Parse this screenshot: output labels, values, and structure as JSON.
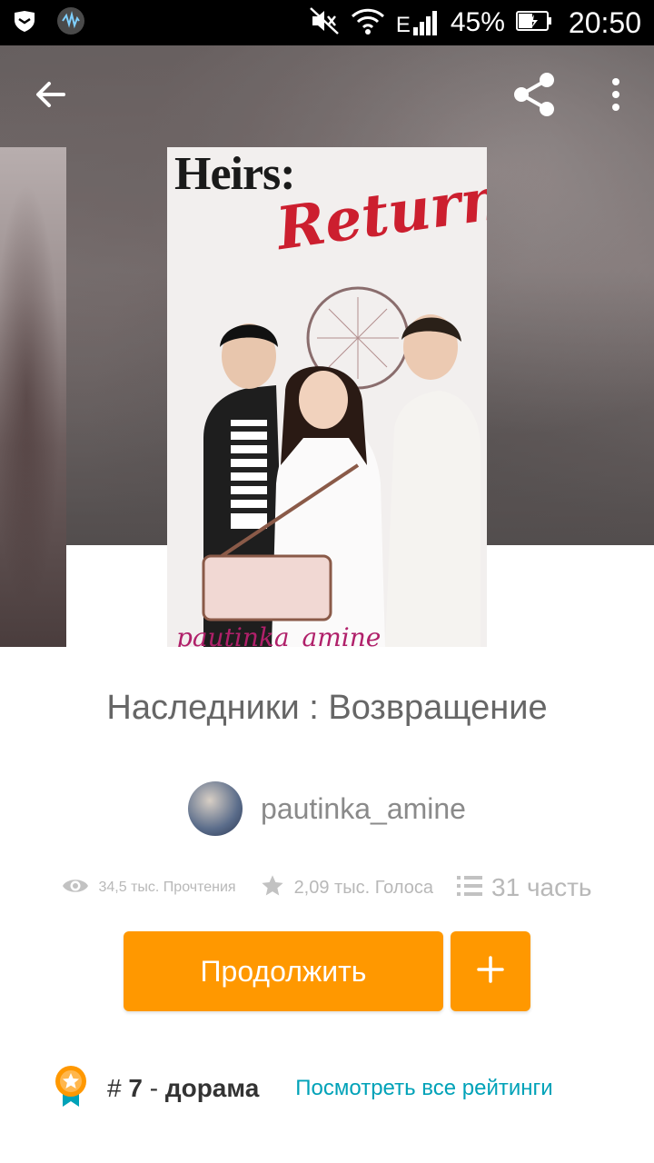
{
  "status_bar": {
    "battery": "45%",
    "time": "20:50",
    "network": "E"
  },
  "toolbar": {
    "icons": [
      "back-arrow-icon",
      "share-icon",
      "more-vert-icon"
    ]
  },
  "cover": {
    "title_text": "Heirs:",
    "subtitle_text": "Return",
    "watermark": "pautinka_amine"
  },
  "story": {
    "title": "Наследники : Возвращение",
    "author": "pautinka_amine",
    "reads": "34,5 тыс. Прочтения",
    "votes": "2,09 тыс. Голоса",
    "parts": "31 часть"
  },
  "actions": {
    "continue_label": "Продолжить",
    "add_label": "+"
  },
  "ranking": {
    "hash": "# ",
    "rank": "7",
    "separator": " - ",
    "tag": "дорама",
    "link": "Посмотреть все рейтинги"
  },
  "colors": {
    "accent": "#ff9800",
    "link": "#00a2b8"
  }
}
